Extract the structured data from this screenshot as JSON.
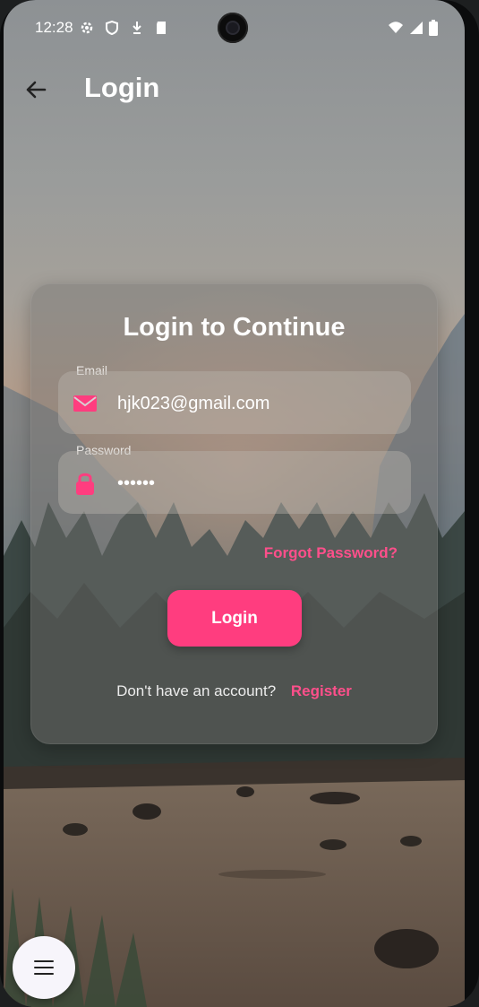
{
  "status": {
    "time": "12:28",
    "left_icons": [
      "settings-icon",
      "shield-icon",
      "download-icon",
      "sd-card-icon"
    ],
    "right_icons": [
      "wifi-icon",
      "signal-icon",
      "battery-icon"
    ]
  },
  "appbar": {
    "title": "Login",
    "back_icon": "arrow-left-icon"
  },
  "card": {
    "title": "Login to Continue",
    "email": {
      "label": "Email",
      "value": "hjk023@gmail.com",
      "icon": "mail-icon"
    },
    "password": {
      "label": "Password",
      "value": "••••••",
      "icon": "lock-icon"
    },
    "forgot_label": "Forgot Password?",
    "login_label": "Login",
    "signup_question": "Don't have an account?",
    "signup_link": "Register"
  },
  "fab": {
    "icon": "menu-icon"
  },
  "colors": {
    "accent": "#ff3d7f",
    "accent_text": "#ff4f8b",
    "text": "#ffffff"
  }
}
